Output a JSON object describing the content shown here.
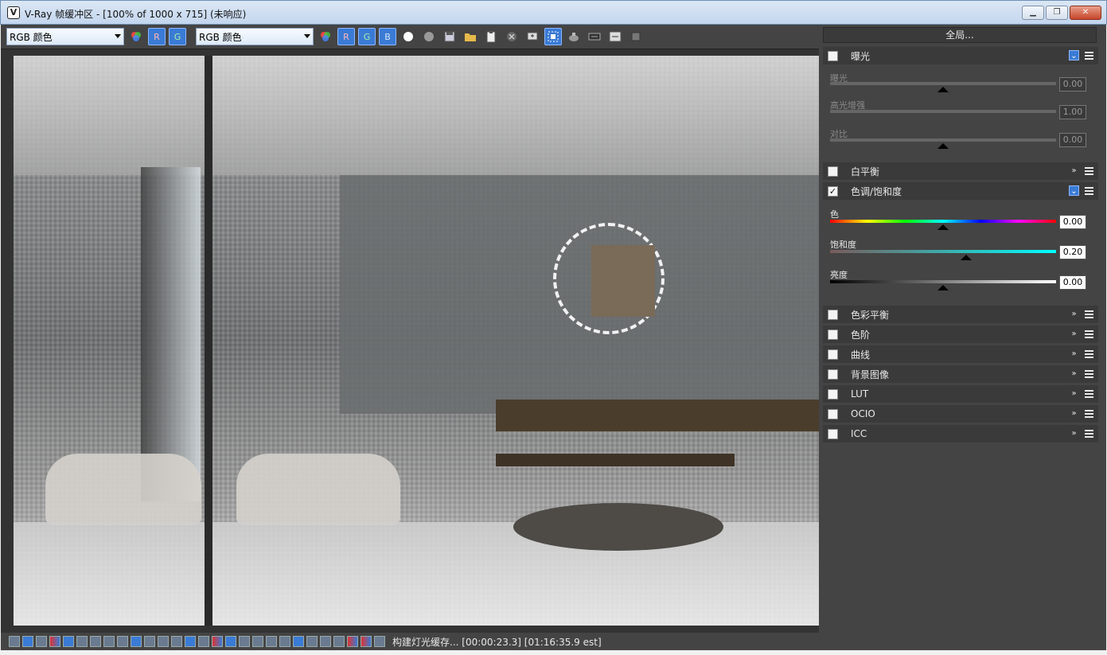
{
  "window": {
    "app_icon_glyph": "V",
    "title": "V-Ray 帧缓冲区 - [100% of 1000 x 715] (未响应)",
    "minimize": "▁",
    "restore": "❐",
    "close": "✕"
  },
  "toolbar": {
    "channel1": "RGB 颜色",
    "channel2": "RGB 颜色",
    "r_label": "R",
    "g_label": "G",
    "b_label": "B"
  },
  "status": {
    "text": "构建灯光缓存... [00:00:23.3] [01:16:35.9 est]"
  },
  "panel": {
    "global_button": "全局...",
    "sections": {
      "exposure": {
        "label": "曝光",
        "checked": false,
        "expanded": true
      },
      "white_balance": {
        "label": "白平衡",
        "checked": false
      },
      "hue_sat": {
        "label": "色调/饱和度",
        "checked": true,
        "expanded": true,
        "check_glyph": "✓"
      },
      "color_balance": {
        "label": "色彩平衡"
      },
      "levels": {
        "label": "色阶"
      },
      "curves": {
        "label": "曲线"
      },
      "background": {
        "label": "背景图像"
      },
      "lut": {
        "label": "LUT"
      },
      "ocio": {
        "label": "OCIO"
      },
      "icc": {
        "label": "ICC"
      }
    },
    "exposure_params": {
      "exposure_label": "曝光",
      "exposure_value": "0.00",
      "highlight_label": "高光增强",
      "highlight_value": "1.00",
      "contrast_label": "对比",
      "contrast_value": "0.00"
    },
    "hue_params": {
      "hue_label": "色",
      "hue_value": "0.00",
      "sat_label": "饱和度",
      "sat_value": "0.20",
      "lum_label": "亮度",
      "lum_value": "0.00"
    },
    "chevron": "»",
    "chevron_down": "⌄"
  },
  "colors": {
    "accent": "#3a7bd5",
    "panel_bg": "#444444",
    "section_bg": "#3a3a3a"
  }
}
